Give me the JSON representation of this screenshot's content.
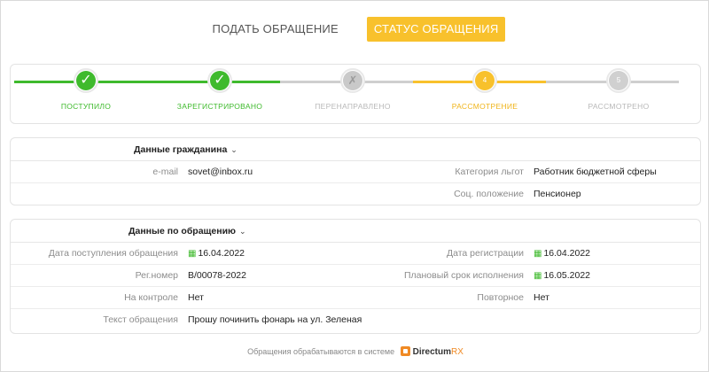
{
  "tabs": {
    "submit": "ПОДАТЬ ОБРАЩЕНИЕ",
    "status": "СТАТУС ОБРАЩЕНИЯ"
  },
  "progress": {
    "steps": [
      {
        "label": "ПОСТУПИЛО",
        "state": "done",
        "marker": "✓"
      },
      {
        "label": "ЗАРЕГИСТРИРОВАНО",
        "state": "done",
        "marker": "✓"
      },
      {
        "label": "ПЕРЕНАПРАВЛЕНО",
        "state": "skipped",
        "marker": "✗"
      },
      {
        "label": "РАССМОТРЕНИЕ",
        "state": "current",
        "marker": "4"
      },
      {
        "label": "РАССМОТРЕНО",
        "state": "pending",
        "marker": "5"
      }
    ]
  },
  "citizen": {
    "title": "Данные гражданина",
    "email_label": "e-mail",
    "email": "sovet@inbox.ru",
    "benefit_label": "Категория льгот",
    "benefit": "Работник бюджетной сферы",
    "social_label": "Соц. положение",
    "social": "Пенсионер"
  },
  "appeal": {
    "title": "Данные по обращению",
    "received_label": "Дата поступления обращения",
    "received": "16.04.2022",
    "registered_label": "Дата регистрации",
    "registered": "16.04.2022",
    "regnum_label": "Рег.номер",
    "regnum": "В/00078-2022",
    "deadline_label": "Плановый срок исполнения",
    "deadline": "16.05.2022",
    "control_label": "На контроле",
    "control": "Нет",
    "repeat_label": "Повторное",
    "repeat": "Нет",
    "text_label": "Текст обращения",
    "text": "Прошу починить фонарь на ул. Зеленая"
  },
  "footer": {
    "text": "Обращения обрабатываются в системе",
    "brand_main": "Directum",
    "brand_suffix": "RX"
  },
  "colors": {
    "accent": "#f8c12c",
    "done": "#3fba2d",
    "inactive": "#c9c9c9",
    "brand": "#f08a24"
  }
}
